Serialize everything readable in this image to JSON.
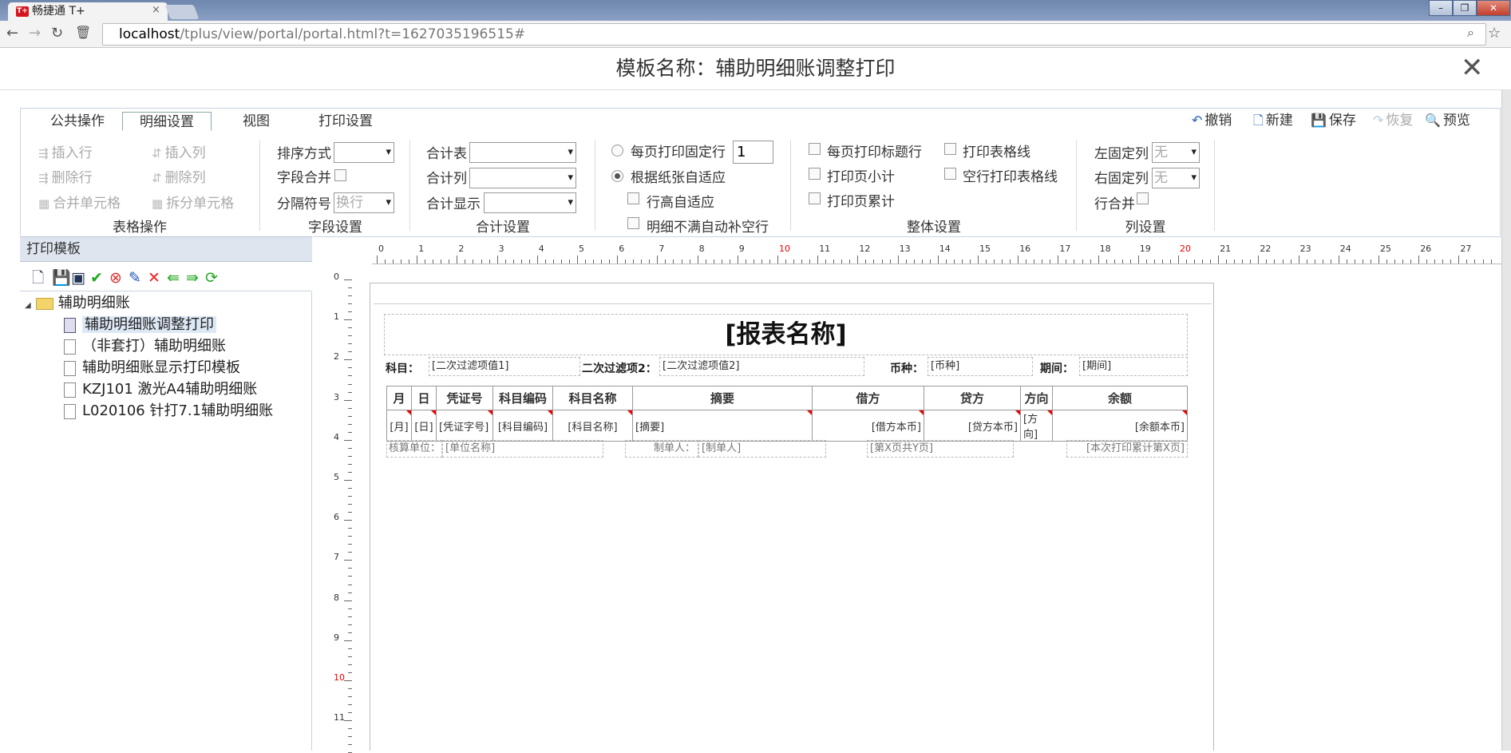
{
  "browser": {
    "tab_title": "畅捷通 T+",
    "tab_icon_text": "T+",
    "url_host": "localhost",
    "url_path": "/tplus/view/portal/portal.html?t=1627035196515#"
  },
  "dialog": {
    "title": "模板名称：辅助明细账调整打印",
    "tabs": [
      "公共操作",
      "明细设置",
      "视图",
      "打印设置"
    ],
    "active_tab": "明细设置",
    "actions": {
      "undo": "撤销",
      "new": "新建",
      "save": "保存",
      "redo": "恢复",
      "preview": "预览"
    },
    "groups": {
      "table_ops": {
        "label": "表格操作",
        "insert_row": "插入行",
        "insert_col": "插入列",
        "delete_row": "删除行",
        "delete_col": "删除列",
        "merge_cells": "合并单元格",
        "split_cells": "拆分单元格"
      },
      "field": {
        "label": "字段设置",
        "sort": "排序方式",
        "sort_value": "",
        "merge": "字段合并",
        "separator": "分隔符号",
        "separator_value": "换行"
      },
      "total": {
        "label": "合计设置",
        "table": "合计表",
        "column": "合计列",
        "display": "合计显示"
      },
      "page_fit": {
        "fixed_rows": "每页打印固定行",
        "fixed_rows_value": "1",
        "fit_paper": "根据纸张自适应",
        "row_height": "行高自适应",
        "fill_blank": "明细不满自动补空行"
      },
      "overall": {
        "label": "整体设置",
        "print_title": "每页打印标题行",
        "print_grid": "打印表格线",
        "page_subtotal": "打印页小计",
        "blank_grid": "空行打印表格线",
        "page_cumulative": "打印页累计"
      },
      "columns": {
        "label": "列设置",
        "left_fixed": "左固定列",
        "left_value": "无",
        "right_fixed": "右固定列",
        "right_value": "无",
        "row_merge": "行合并"
      }
    }
  },
  "tree": {
    "header": "打印模板",
    "root": "辅助明细账",
    "items": [
      "辅助明细账调整打印",
      "（非套打）辅助明细账",
      "辅助明细账显示打印模板",
      "KZJ101 激光A4辅助明细账",
      "L020106 针打7.1辅助明细账"
    ],
    "selected": "辅助明细账调整打印"
  },
  "ruler": {
    "h": [
      "0",
      "1",
      "2",
      "3",
      "4",
      "5",
      "6",
      "7",
      "8",
      "9",
      "10",
      "11",
      "12",
      "13",
      "14",
      "15",
      "16",
      "17",
      "18",
      "19",
      "20",
      "21",
      "22",
      "23",
      "24",
      "25",
      "26",
      "27"
    ],
    "v": [
      "0",
      "1",
      "2",
      "3",
      "4",
      "5",
      "6",
      "7",
      "8",
      "9",
      "10",
      "11"
    ]
  },
  "report": {
    "title": "[报表名称]",
    "subject_label": "科目：",
    "subject_value": "[二次过滤项值1]",
    "filter2_label": "二次过滤项2：",
    "filter2_value": "[二次过滤项值2]",
    "currency_label": "币种：",
    "currency_value": "[币种]",
    "period_label": "期间：",
    "period_value": "[期间]",
    "headers": [
      "月",
      "日",
      "凭证号",
      "科目编码",
      "科目名称",
      "摘要",
      "借方",
      "贷方",
      "方向",
      "余额"
    ],
    "fields": [
      "[月]",
      "[日]",
      "[凭证字号]",
      "[科目编码]",
      "[科目名称]",
      "[摘要]",
      "[借方本币]",
      "[贷方本币]",
      "[方向]",
      "[余额本币]"
    ],
    "footer": {
      "unit_label": "核算单位：",
      "unit_value": "[单位名称]",
      "maker_label": "制单人：",
      "maker_value": "[制单人]",
      "page": "[第X页共Y页]",
      "cumulative": "[本次打印累计第X页]"
    }
  }
}
